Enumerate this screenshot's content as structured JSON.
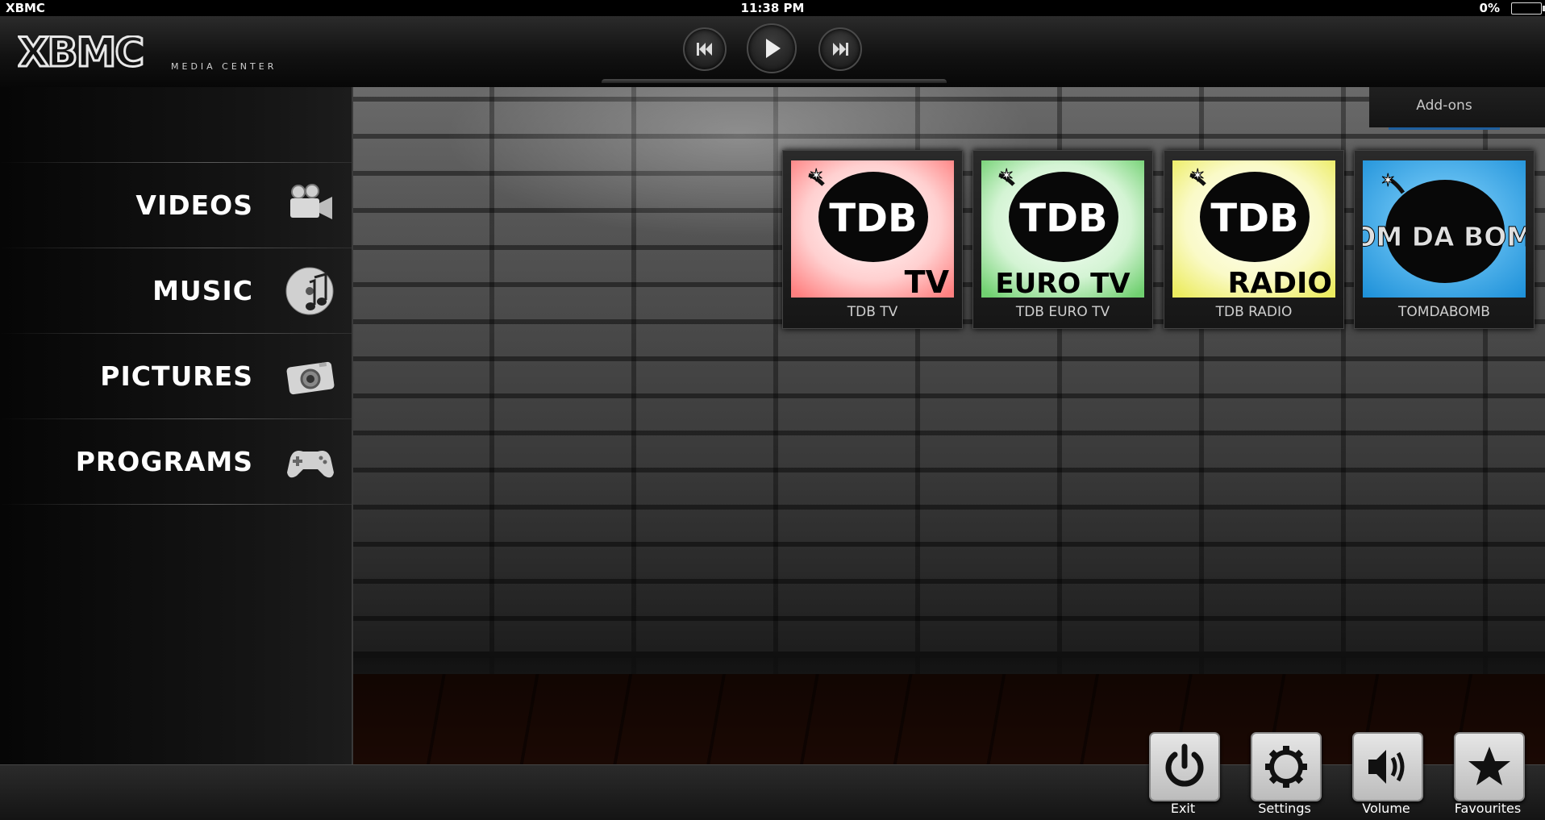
{
  "status": {
    "app_name": "XBMC",
    "time": "11:38 PM",
    "battery": "0%"
  },
  "header": {
    "logo_text": "XBMC",
    "logo_subtitle": "MEDIA CENTER"
  },
  "transport": {
    "prev_icon": "skip-back-icon",
    "play_icon": "play-icon",
    "next_icon": "skip-forward-icon"
  },
  "menu": {
    "items": [
      {
        "label": "VIDEOS",
        "icon": "film-camera-icon"
      },
      {
        "label": "MUSIC",
        "icon": "music-disc-icon"
      },
      {
        "label": "PICTURES",
        "icon": "photo-camera-icon"
      },
      {
        "label": "PROGRAMS",
        "icon": "gamepad-icon"
      }
    ]
  },
  "subtab": {
    "label": "Add-ons"
  },
  "addons": [
    {
      "name": "TDB TV",
      "art_top": "TDB",
      "art_bottom": "TV",
      "bg": "#ff9a9a"
    },
    {
      "name": "TDB EURO TV",
      "art_top": "TDB",
      "art_bottom": "EURO TV",
      "bg": "#a4e8a4"
    },
    {
      "name": "TDB RADIO",
      "art_top": "TDB",
      "art_bottom": "RADIO",
      "bg": "#f2f29a"
    },
    {
      "name": "TOMDABOMB",
      "art_top": "TOM DA BOMB",
      "art_bottom": "",
      "bg": "#3aaee8"
    }
  ],
  "bottom_buttons": [
    {
      "label": "Exit",
      "icon": "power-icon"
    },
    {
      "label": "Settings",
      "icon": "gear-icon"
    },
    {
      "label": "Volume",
      "icon": "speaker-icon"
    },
    {
      "label": "Favourites",
      "icon": "star-icon"
    }
  ]
}
